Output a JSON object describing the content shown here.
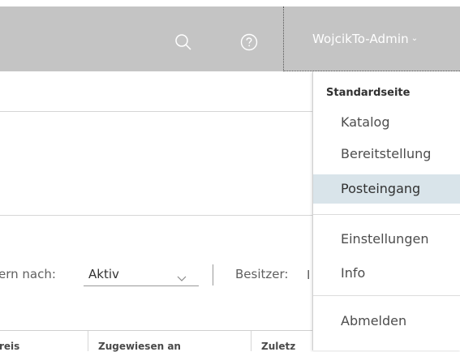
{
  "header": {
    "user_name": "WojcikTo-Admin",
    "user_caret": "⌄"
  },
  "filter": {
    "label_partial": "ern nach:",
    "status_value": "Aktiv",
    "owner_label": "Besitzer:",
    "owner_partial": "I"
  },
  "table": {
    "columns": [
      "reis",
      "Zugewiesen an",
      "Zuletz"
    ]
  },
  "dropdown": {
    "heading": "Standardseite",
    "items": [
      {
        "label": "Katalog"
      },
      {
        "label": "Bereitstellung"
      },
      {
        "label": "Posteingang"
      }
    ],
    "items2": [
      {
        "label": "Einstellungen"
      },
      {
        "label": "Info"
      }
    ],
    "logout": "Abmelden"
  },
  "colors": {
    "header_bg": "#c4c4c4",
    "active_item_bg": "#d9e4ea"
  }
}
